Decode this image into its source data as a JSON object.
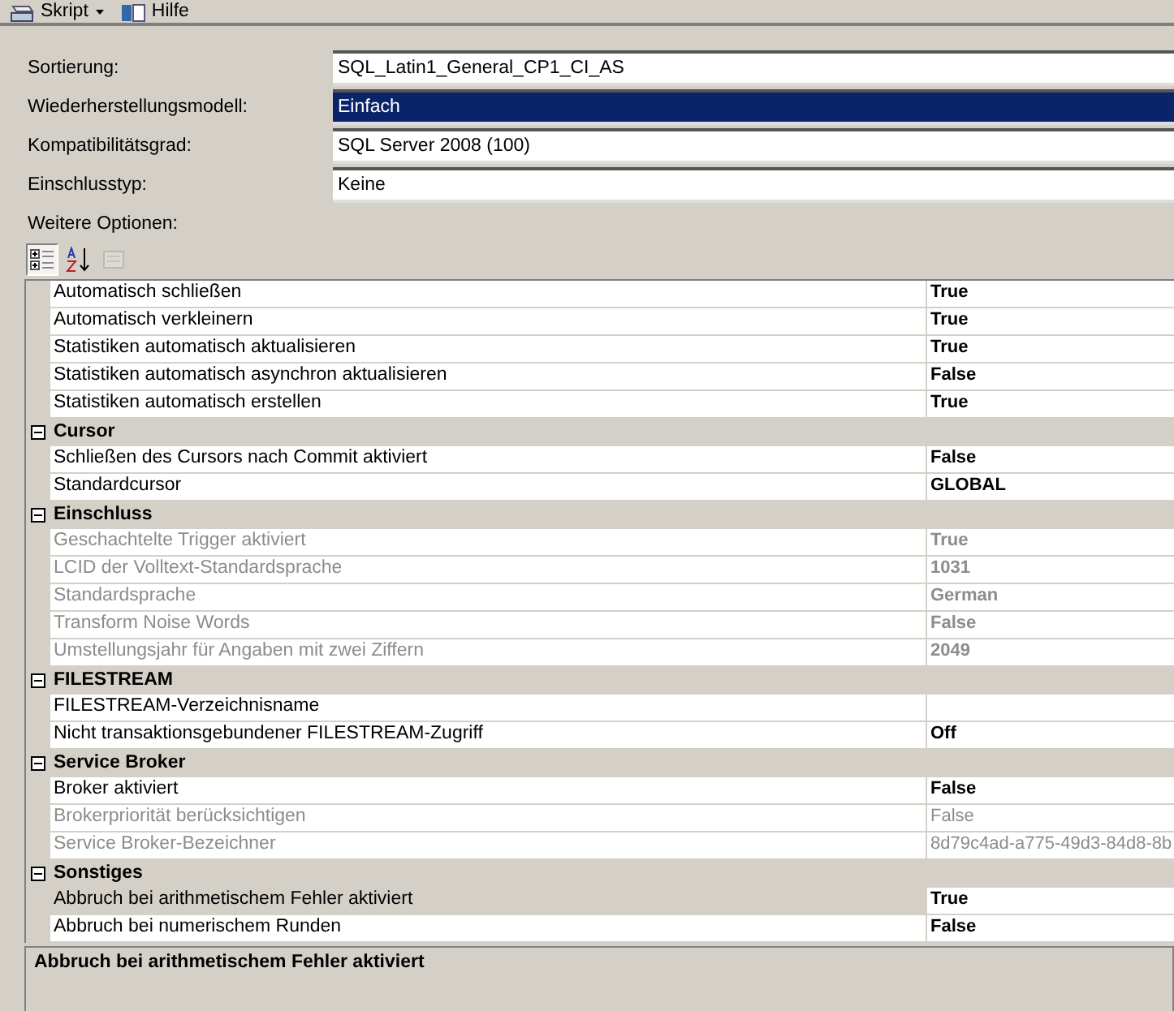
{
  "toolbar": [
    {
      "kind": "script",
      "label": "Skript",
      "dropdown": true
    },
    {
      "kind": "help",
      "label": "Hilfe",
      "dropdown": false
    }
  ],
  "fields": [
    {
      "label": "Sortierung:",
      "value": "SQL_Latin1_General_CP1_CI_AS",
      "selected": false
    },
    {
      "label": "Wiederherstellungsmodell:",
      "value": "Einfach",
      "selected": true
    },
    {
      "label": "Kompatibilitätsgrad:",
      "value": "SQL Server 2008 (100)",
      "selected": false
    },
    {
      "label": "Einschlusstyp:",
      "value": "Keine",
      "selected": false
    }
  ],
  "options_label": "Weitere Optionen:",
  "grid_toolbar": [
    {
      "kind": "categorized",
      "selected": true,
      "disabled": false
    },
    {
      "kind": "alphabetical",
      "selected": false,
      "disabled": false
    },
    {
      "kind": "property-pages",
      "selected": false,
      "disabled": true
    }
  ],
  "grid": {
    "properties": [
      {
        "name": "Automatisch schließen",
        "value": "True",
        "bold": true,
        "disabled": false,
        "selected": false
      },
      {
        "name": "Automatisch verkleinern",
        "value": "True",
        "bold": true,
        "disabled": false,
        "selected": false
      },
      {
        "name": "Statistiken automatisch aktualisieren",
        "value": "True",
        "bold": true,
        "disabled": false,
        "selected": false
      },
      {
        "name": "Statistiken automatisch asynchron aktualisieren",
        "value": "False",
        "bold": true,
        "disabled": false,
        "selected": false
      },
      {
        "name": "Statistiken automatisch erstellen",
        "value": "True",
        "bold": true,
        "disabled": false,
        "selected": false
      }
    ],
    "categories": [
      {
        "name": "Cursor",
        "expanded": true,
        "children": [
          {
            "name": "Schließen des Cursors nach Commit aktiviert",
            "value": "False",
            "bold": true,
            "disabled": false,
            "selected": false
          },
          {
            "name": "Standardcursor",
            "value": "GLOBAL",
            "bold": true,
            "disabled": false,
            "selected": false
          }
        ]
      },
      {
        "name": "Einschluss",
        "expanded": true,
        "children": [
          {
            "name": "Geschachtelte Trigger aktiviert",
            "value": "True",
            "bold": true,
            "disabled": true,
            "selected": false
          },
          {
            "name": "LCID der Volltext-Standardsprache",
            "value": "1031",
            "bold": true,
            "disabled": true,
            "selected": false
          },
          {
            "name": "Standardsprache",
            "value": "German",
            "bold": true,
            "disabled": true,
            "selected": false
          },
          {
            "name": "Transform Noise Words",
            "value": "False",
            "bold": true,
            "disabled": true,
            "selected": false
          },
          {
            "name": "Umstellungsjahr für Angaben mit zwei Ziffern",
            "value": "2049",
            "bold": true,
            "disabled": true,
            "selected": false
          }
        ]
      },
      {
        "name": "FILESTREAM",
        "expanded": true,
        "children": [
          {
            "name": "FILESTREAM-Verzeichnisname",
            "disabled": false,
            "selected": false
          },
          {
            "name": "Nicht transaktionsgebundener FILESTREAM-Zugriff",
            "value": "Off",
            "bold": true,
            "disabled": false,
            "selected": false
          }
        ]
      },
      {
        "name": "Service Broker",
        "expanded": true,
        "children": [
          {
            "name": "Broker aktiviert",
            "value": "False",
            "bold": true,
            "disabled": false,
            "selected": false
          },
          {
            "name": "Brokerpriorität berücksichtigen",
            "value": "False",
            "bold": false,
            "disabled": true,
            "selected": false
          },
          {
            "name": "Service Broker-Bezeichner",
            "value": "8d79c4ad-a775-49d3-84d8-8b",
            "bold": false,
            "disabled": true,
            "selected": false
          }
        ]
      },
      {
        "name": "Sonstiges",
        "expanded": true,
        "children": [
          {
            "name": "Abbruch bei arithmetischem Fehler aktiviert",
            "value": "True",
            "bold": true,
            "disabled": false,
            "selected": true
          },
          {
            "name": "Abbruch bei numerischem Runden",
            "value": "False",
            "bold": true,
            "disabled": false,
            "selected": false
          }
        ]
      }
    ]
  },
  "description": {
    "title": "Abbruch bei arithmetischem Fehler aktiviert"
  }
}
